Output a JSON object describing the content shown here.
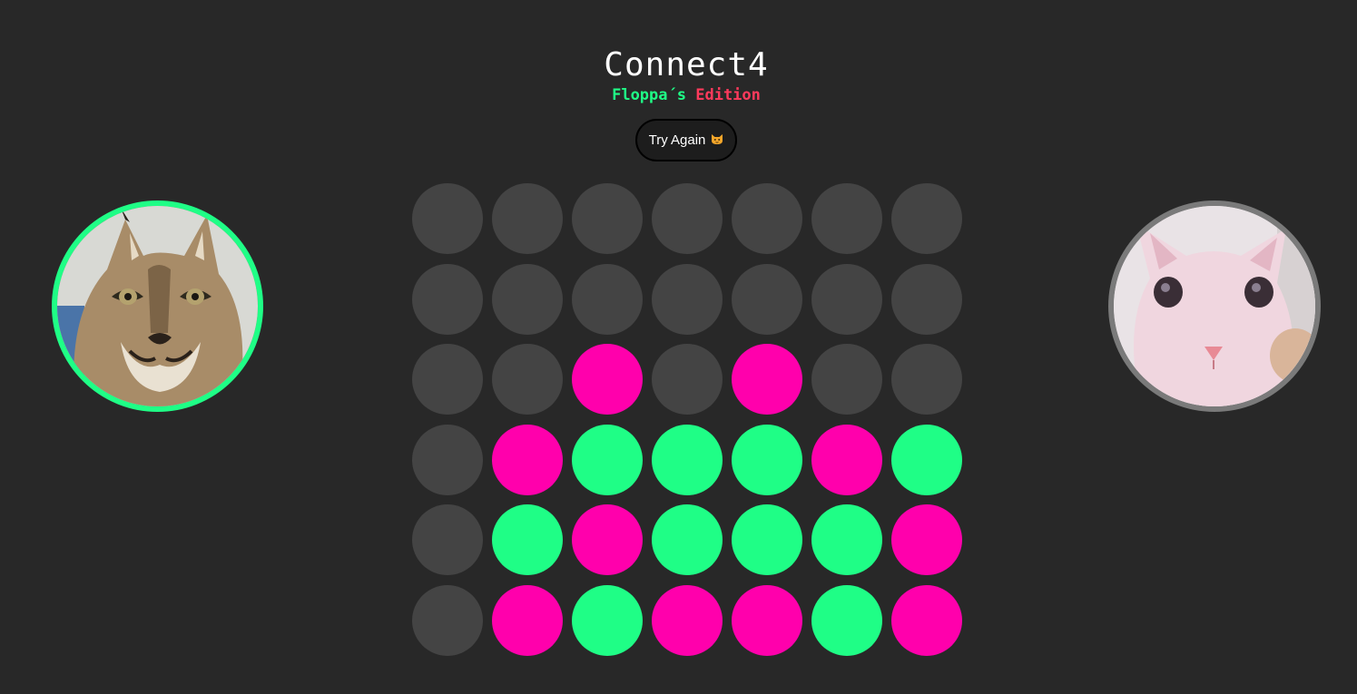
{
  "header": {
    "title": "Connect4",
    "subtitle_part1": "Floppa´s",
    "subtitle_part2": "Edition"
  },
  "controls": {
    "try_again_label": "Try Again",
    "try_again_icon": "cat-face-icon"
  },
  "colors": {
    "background": "#282828",
    "empty_cell": "#444444",
    "player1": "#1ffe86",
    "player2": "#ff00ac",
    "subtitle_accent": "#ff3a5c",
    "inactive_ring": "#7a7a7a"
  },
  "players": [
    {
      "id": "player1",
      "avatar": "floppa-caracal-photo",
      "active": true,
      "color": "#1ffe86"
    },
    {
      "id": "player2",
      "avatar": "bingus-sphynx-photo",
      "active": false,
      "color": "#7a7a7a"
    }
  ],
  "board": {
    "rows": 6,
    "columns": 7,
    "cells": [
      [
        "empty",
        "empty",
        "empty",
        "empty",
        "empty",
        "empty",
        "empty"
      ],
      [
        "empty",
        "empty",
        "empty",
        "empty",
        "empty",
        "empty",
        "empty"
      ],
      [
        "empty",
        "empty",
        "p2",
        "empty",
        "p2",
        "empty",
        "empty"
      ],
      [
        "empty",
        "p2",
        "p1",
        "p1",
        "p1",
        "p2",
        "p1"
      ],
      [
        "empty",
        "p1",
        "p2",
        "p1",
        "p1",
        "p1",
        "p2"
      ],
      [
        "empty",
        "p2",
        "p1",
        "p2",
        "p2",
        "p1",
        "p2"
      ]
    ]
  }
}
